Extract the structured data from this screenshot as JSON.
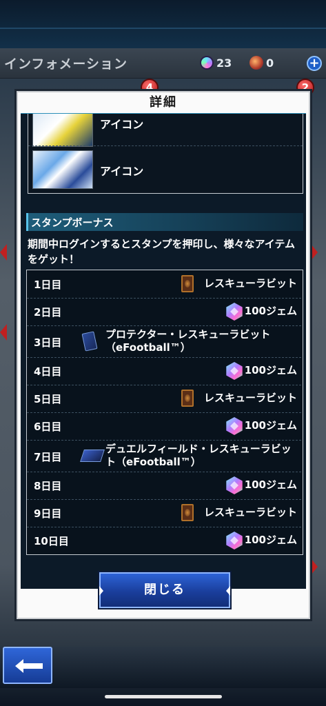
{
  "header": {
    "title": "インフォメーション",
    "gem_count": "23",
    "orb_count": "0"
  },
  "badges": {
    "left": "4",
    "right": "2"
  },
  "dialog": {
    "title": "詳細",
    "icon_rows": [
      {
        "label": "アイコン"
      },
      {
        "label": "アイコン"
      }
    ],
    "section_title": "スタンプボーナス",
    "description": "期間中ログインするとスタンプを押印し、様々なアイテムをゲット！",
    "stamps": [
      {
        "day": "1日目",
        "reward": "レスキューラビット",
        "icon": "card-icon"
      },
      {
        "day": "2日目",
        "reward": "100ジェム",
        "icon": "gem-icon"
      },
      {
        "day": "3日目",
        "reward": "プロテクター・レスキューラビット（eFootball™）",
        "icon": "protector-icon"
      },
      {
        "day": "4日目",
        "reward": "100ジェム",
        "icon": "gem-icon"
      },
      {
        "day": "5日目",
        "reward": "レスキューラビット",
        "icon": "card-icon"
      },
      {
        "day": "6日目",
        "reward": "100ジェム",
        "icon": "gem-icon"
      },
      {
        "day": "7日目",
        "reward": "デュエルフィールド・レスキューラビット（eFootball™）",
        "icon": "duel-field-icon"
      },
      {
        "day": "8日目",
        "reward": "100ジェム",
        "icon": "gem-icon"
      },
      {
        "day": "9日目",
        "reward": "レスキューラビット",
        "icon": "card-icon"
      },
      {
        "day": "10日目",
        "reward": "100ジェム",
        "icon": "gem-icon"
      }
    ],
    "close_label": "閉じる"
  },
  "colors": {
    "accent_blue": "#2d63d6",
    "scroll_accent": "#e0b21a",
    "section_blue": "#1e5d7a"
  }
}
